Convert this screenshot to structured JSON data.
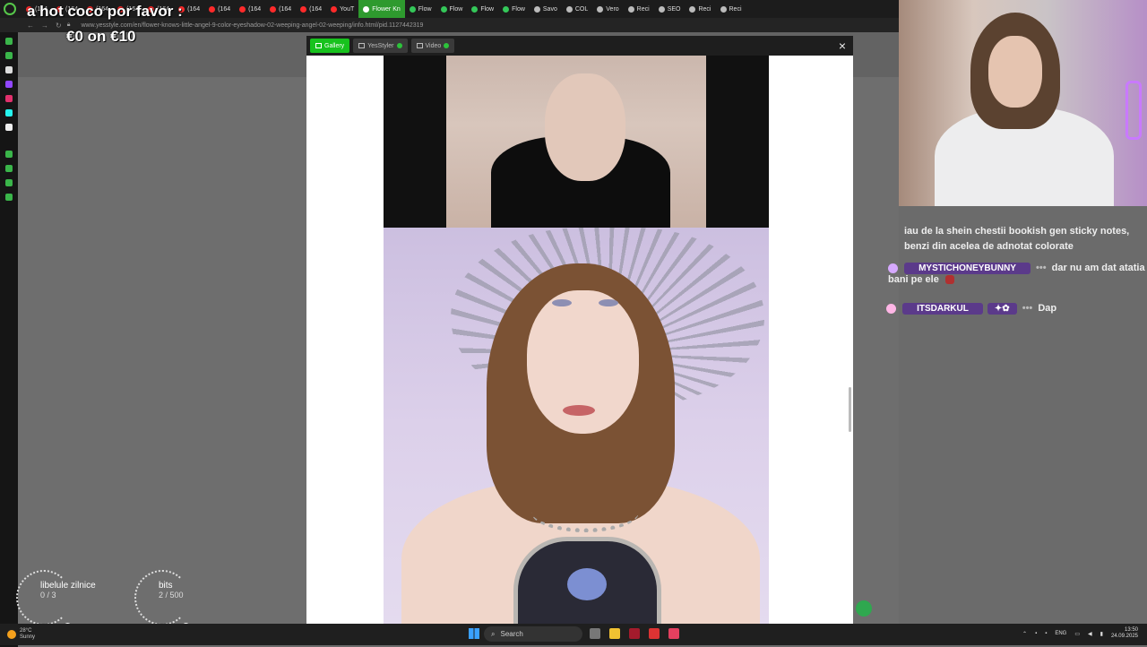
{
  "browser": {
    "tabs": [
      {
        "label": "(164",
        "color": "#ff2a2a"
      },
      {
        "label": "(164",
        "color": "#ff2a2a"
      },
      {
        "label": "(164",
        "color": "#ff2a2a"
      },
      {
        "label": "(164",
        "color": "#ff2a2a"
      },
      {
        "label": "(164",
        "color": "#ff2a2a"
      },
      {
        "label": "(164",
        "color": "#ff2a2a"
      },
      {
        "label": "(164",
        "color": "#ff2a2a"
      },
      {
        "label": "(164",
        "color": "#ff2a2a"
      },
      {
        "label": "(164",
        "color": "#ff2a2a"
      },
      {
        "label": "(164",
        "color": "#ff2a2a"
      },
      {
        "label": "YouT",
        "color": "#ff2a2a"
      },
      {
        "label": "Flower Kn",
        "color": "#ffffff",
        "active": true
      },
      {
        "label": "Flow",
        "color": "#34c759"
      },
      {
        "label": "Flow",
        "color": "#34c759"
      },
      {
        "label": "Flow",
        "color": "#34c759"
      },
      {
        "label": "Flow",
        "color": "#34c759"
      },
      {
        "label": "Savo",
        "color": "#bbbbbb"
      },
      {
        "label": "COL",
        "color": "#bbbbbb"
      },
      {
        "label": "Vero",
        "color": "#bbbbbb"
      },
      {
        "label": "Reci",
        "color": "#bbbbbb"
      },
      {
        "label": "SEO",
        "color": "#bbbbbb"
      },
      {
        "label": "Reci",
        "color": "#bbbbbb"
      },
      {
        "label": "Reci",
        "color": "#bbbbbb"
      }
    ],
    "url": "www.yesstyle.com/en/flower-knows-little-angel-9-color-eyeshadow-02-weeping-angel-02-weeping/info.html/pid.1127442319"
  },
  "modal": {
    "tabs": [
      {
        "label": "Gallery",
        "active": true
      },
      {
        "label": "YesStyler",
        "active": false
      },
      {
        "label": "Video",
        "active": false
      }
    ],
    "close_label": "×"
  },
  "goal": {
    "title": "a hot coco por favor :",
    "amount": "€0 on €10"
  },
  "chat": {
    "messages": [
      {
        "text": "iau de la shein chestii bookish gen sticky notes, benzi din acelea de adnotat colorate"
      },
      {
        "user": "MYSTICHONEYBUNNY",
        "text": "dar nu am dat atatia bani pe ele"
      },
      {
        "user": "ITSDARKUL",
        "text": "Dap"
      }
    ],
    "dots": "•••"
  },
  "widgets": [
    {
      "name": "libelule zilnice",
      "value": "0 / 3"
    },
    {
      "name": "bits",
      "value": "2 / 500"
    }
  ],
  "taskbar": {
    "weather_temp": "28°C",
    "weather_desc": "Sunny",
    "search_placeholder": "Search",
    "language": "ENG",
    "time": "13:50",
    "date": "24.09.2025"
  },
  "colors": {
    "accent_green": "#17c21d",
    "username_bg": "#5b3a8a"
  }
}
